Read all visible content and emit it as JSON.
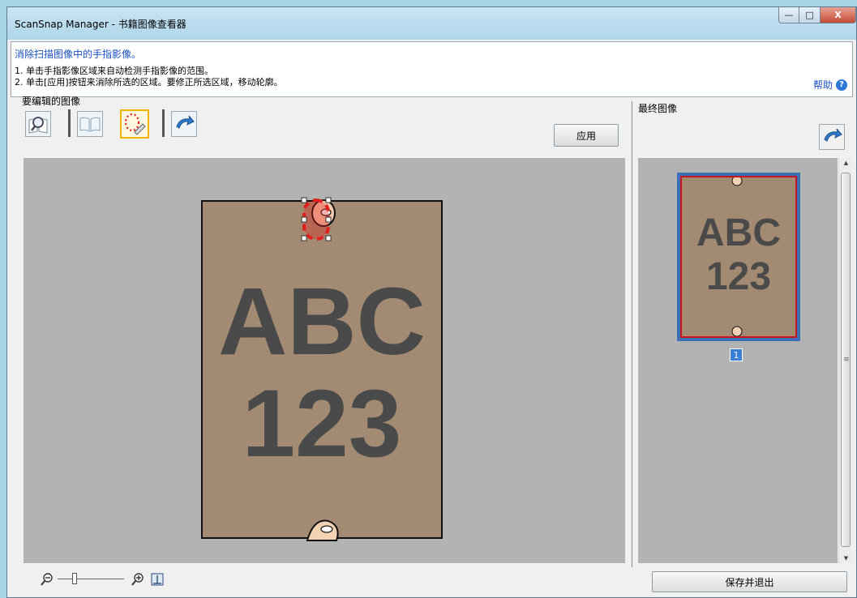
{
  "window": {
    "title": "ScanSnap Manager - 书籍图像查看器",
    "min_label": "—",
    "max_label": "□",
    "close_label": "X"
  },
  "instructions": {
    "heading": "消除扫描图像中的手指影像。",
    "step1": "1. 单击手指影像区域来自动检测手指影像的范围。",
    "step2": "2. 单击[应用]按钮来消除所选的区域。要修正所选区域，移动轮廓。",
    "help_label": "帮助",
    "help_icon": "?"
  },
  "left_panel": {
    "label": "要编辑的图像",
    "apply_label": "应用",
    "page_text_line1": "ABC",
    "page_text_line2": "123"
  },
  "right_panel": {
    "label": "最终图像",
    "page_number": "1",
    "thumb_line1": "ABC",
    "thumb_line2": "123"
  },
  "footer": {
    "save_exit_label": "保存并退出"
  },
  "colors": {
    "page_fill": "#a38a72",
    "selection": "#e0201b",
    "highlight": "#f2b600",
    "link": "#1a4fc4"
  }
}
